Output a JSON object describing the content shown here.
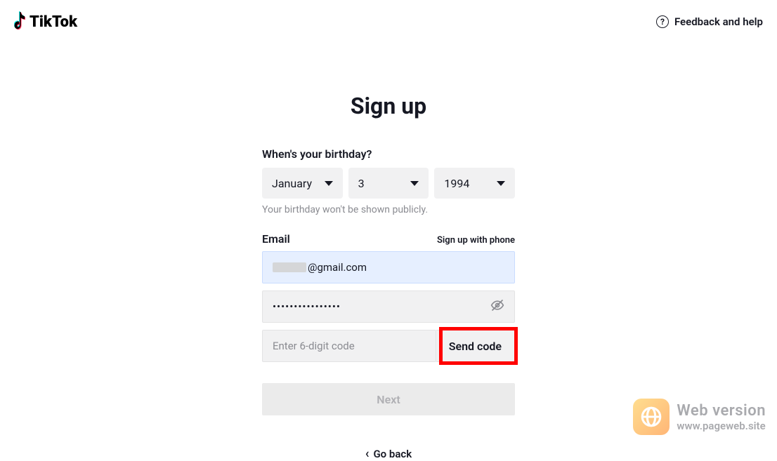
{
  "header": {
    "brand": "TikTok",
    "help_label": "Feedback and help"
  },
  "form": {
    "title": "Sign up",
    "birthday_label": "When's your birthday?",
    "month_value": "January",
    "day_value": "3",
    "year_value": "1994",
    "birthday_hint": "Your birthday won't be shown publicly.",
    "email_label": "Email",
    "phone_link": "Sign up with phone",
    "email_value": "@gmail.com",
    "password_value": "••••••••••••••••",
    "code_placeholder": "Enter 6-digit code",
    "send_code_label": "Send code",
    "next_label": "Next",
    "go_back_label": "Go back"
  },
  "watermark": {
    "line1": "Web version",
    "line2": "www.pageweb.site"
  }
}
